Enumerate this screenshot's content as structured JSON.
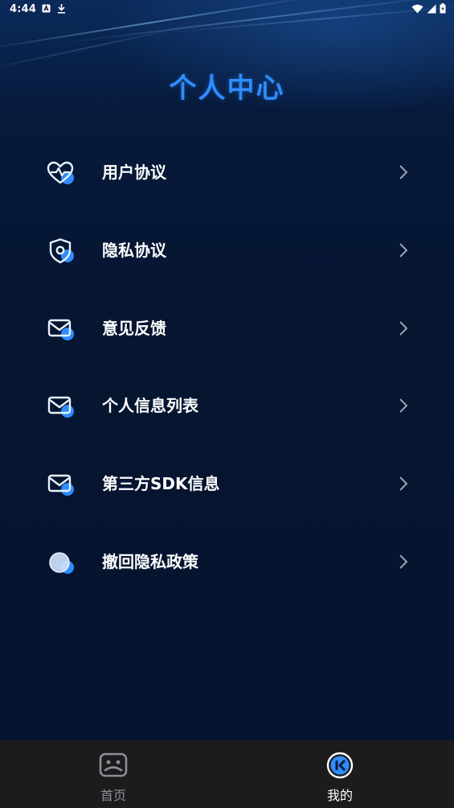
{
  "status_bar": {
    "time": "4:44"
  },
  "header": {
    "title": "个人中心"
  },
  "menu": {
    "items": [
      {
        "label": "用户协议",
        "icon": "heart-pulse-icon"
      },
      {
        "label": "隐私协议",
        "icon": "shield-icon"
      },
      {
        "label": "意见反馈",
        "icon": "mail-icon"
      },
      {
        "label": "个人信息列表",
        "icon": "mail-icon"
      },
      {
        "label": "第三方SDK信息",
        "icon": "mail-icon"
      },
      {
        "label": "撤回隐私政策",
        "icon": "circle-icon"
      }
    ]
  },
  "tabbar": {
    "tabs": [
      {
        "label": "首页",
        "icon": "home-face-icon",
        "active": false
      },
      {
        "label": "我的",
        "icon": "profile-icon",
        "active": true
      }
    ]
  },
  "colors": {
    "accent": "#2f8cff",
    "background": "#061430",
    "tabbar": "#1c1c1e",
    "inactive_tab": "#8e8e93",
    "active_tab": "#ffffff"
  }
}
